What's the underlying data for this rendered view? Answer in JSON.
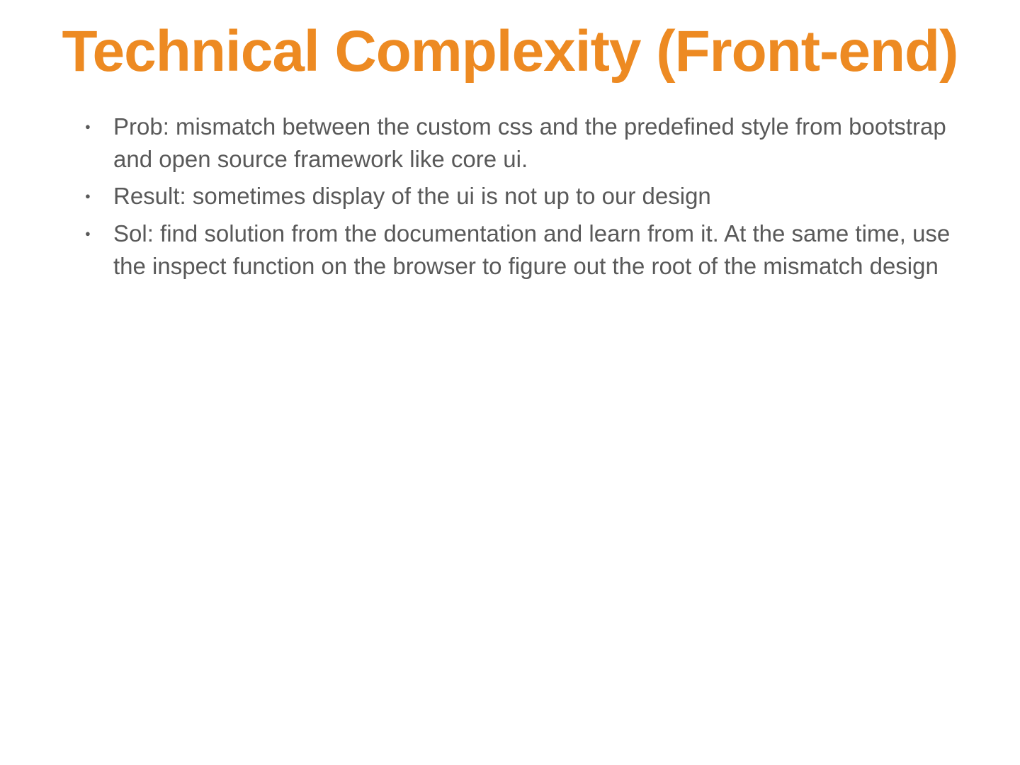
{
  "slide": {
    "title": "Technical Complexity (Front-end)",
    "bullets": [
      "Prob: mismatch between the custom css and the predefined style from bootstrap and open source framework like core ui.",
      "Result: sometimes display of the ui is not up to our design",
      "Sol: find solution from the documentation and learn from it. At the same time, use the inspect function on the browser to figure out the root of the mismatch design"
    ]
  }
}
